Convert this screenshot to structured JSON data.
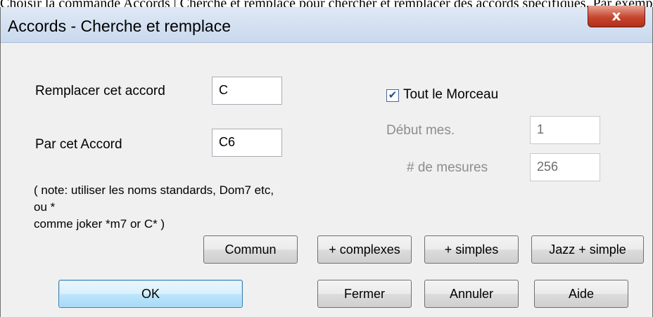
{
  "page_header": {
    "text": "Choisir la commande Accords | Cherche et remplace pour chercher et remplacer des accords spécifiques. Par exemple, remplacer tous"
  },
  "dialog": {
    "title": "Accords - Cherche et remplace",
    "close_symbol": "x"
  },
  "form": {
    "replace_label": "Remplacer cet accord",
    "replace_value": "C",
    "with_label": "Par cet Accord",
    "with_value": "C6",
    "note_line1": "( note: utiliser les noms standards, Dom7 etc, ou *",
    "note_line2": "comme joker *m7 or C* )",
    "whole_song_label": "Tout le Morceau",
    "whole_song_checked": true,
    "check_symbol": "✔",
    "start_bar_label": "Début mes.",
    "start_bar_value": "1",
    "bars_count_label": "# de mesures",
    "bars_count_value": "256"
  },
  "preset_buttons": {
    "common": "Commun",
    "complex": "+ complexes",
    "simple": "+ simples",
    "jazz_simple": "Jazz + simple"
  },
  "action_buttons": {
    "ok": "OK",
    "close": "Fermer",
    "cancel": "Annuler",
    "help": "Aide"
  }
}
